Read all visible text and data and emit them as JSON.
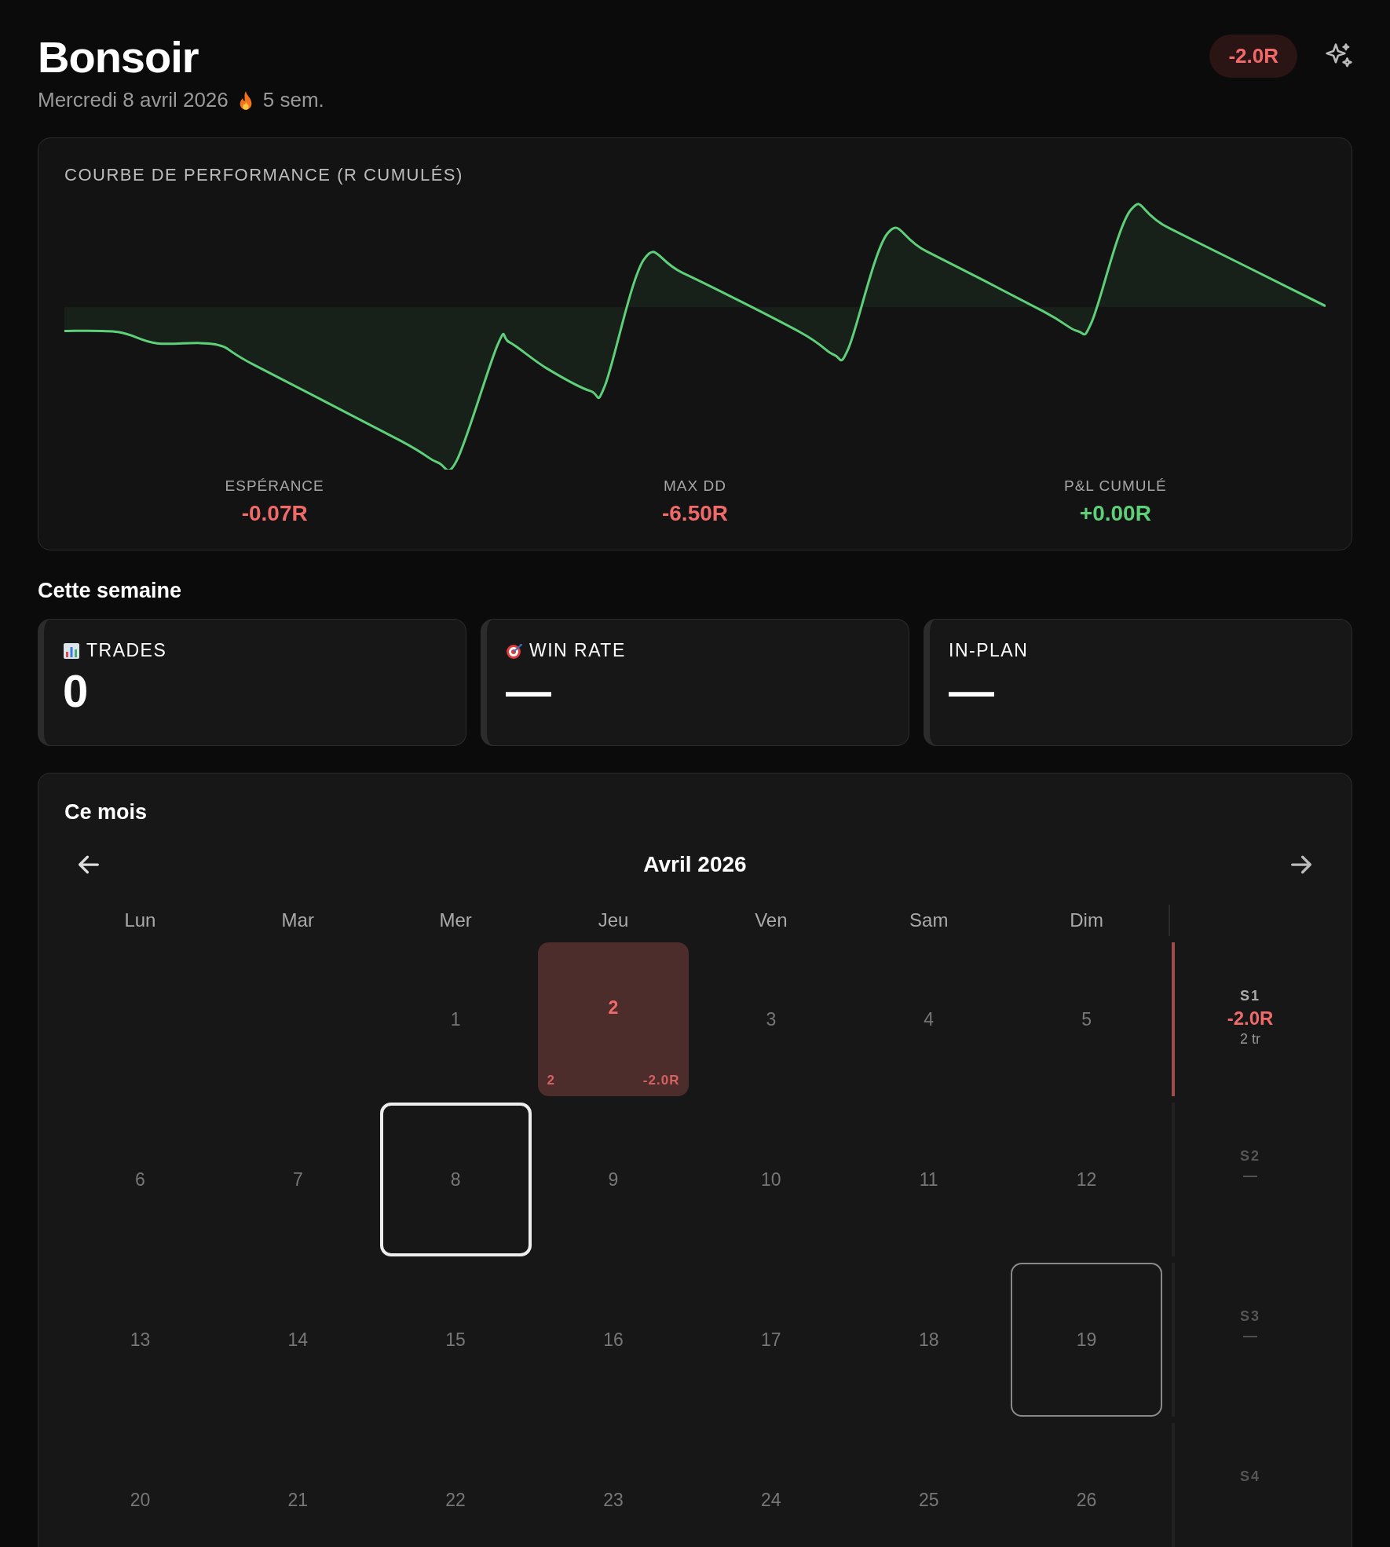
{
  "header": {
    "greeting": "Bonsoir",
    "date": "Mercredi 8 avril 2026",
    "streak": "5 sem.",
    "badge": {
      "text": "-2.0R"
    }
  },
  "performance": {
    "title": "COURBE DE PERFORMANCE (R CUMULÉS)",
    "stats": [
      {
        "label": "ESPÉRANCE",
        "value": "-0.07R",
        "color": "#f06a6a"
      },
      {
        "label": "MAX DD",
        "value": "-6.50R",
        "color": "#f06a6a"
      },
      {
        "label": "P&L CUMULÉ",
        "value": "+0.00R",
        "color": "#5fd07a"
      }
    ]
  },
  "week": {
    "title": "Cette semaine",
    "cards": [
      {
        "kind": "chart",
        "label": "TRADES",
        "value": "0"
      },
      {
        "kind": "target",
        "label": "WIN RATE",
        "value": "—"
      },
      {
        "kind": "plain",
        "label": "IN-PLAN",
        "value": "—"
      }
    ]
  },
  "month": {
    "title": "Ce mois",
    "period": "Avril 2026",
    "weekdays": [
      "Lun",
      "Mar",
      "Mer",
      "Jeu",
      "Ven",
      "Sam",
      "Dim"
    ],
    "weeks": [
      {
        "label": "S1",
        "pnl": "-2.0R",
        "trades": "2 tr",
        "color": "#f06a6a",
        "days": [
          {
            "day": "1",
            "color": "#777777",
            "today": false,
            "selected": false
          },
          {
            "day": "2",
            "trades": "2",
            "pnl": "-2.0R",
            "color": "#f06a6a",
            "today": false,
            "selected": false
          },
          {
            "day": "3",
            "color": "#777777",
            "today": false,
            "selected": false
          },
          {
            "day": "4",
            "color": "#777777",
            "today": false,
            "selected": false
          },
          {
            "day": "5",
            "color": "#777777",
            "today": false,
            "selected": false
          }
        ]
      },
      {
        "label": "S2",
        "pnl": "—",
        "color": "#555555",
        "days": [
          {
            "day": "6",
            "color": "#777777",
            "today": false,
            "selected": false
          },
          {
            "day": "7",
            "color": "#777777",
            "today": false,
            "selected": false
          },
          {
            "day": "8",
            "color": "#777777",
            "today": true,
            "selected": false
          },
          {
            "day": "9",
            "color": "#777777",
            "today": false,
            "selected": false
          },
          {
            "day": "10",
            "color": "#777777",
            "today": false,
            "selected": false
          },
          {
            "day": "11",
            "color": "#777777",
            "today": false,
            "selected": false
          },
          {
            "day": "12",
            "color": "#777777",
            "today": false,
            "selected": false
          }
        ]
      },
      {
        "label": "S3",
        "pnl": "—",
        "color": "#555555",
        "days": [
          {
            "day": "13",
            "color": "#777777",
            "today": false,
            "selected": false
          },
          {
            "day": "14",
            "color": "#777777",
            "today": false,
            "selected": false
          },
          {
            "day": "15",
            "color": "#777777",
            "today": false,
            "selected": false
          },
          {
            "day": "16",
            "color": "#777777",
            "today": false,
            "selected": false
          },
          {
            "day": "17",
            "color": "#777777",
            "today": false,
            "selected": false
          },
          {
            "day": "18",
            "color": "#777777",
            "today": false,
            "selected": false
          },
          {
            "day": "19",
            "color": "#777777",
            "today": false,
            "selected": true
          }
        ]
      },
      {
        "label": "S4",
        "color": "#555555",
        "days": [
          {
            "day": "20",
            "color": "#777777",
            "today": false,
            "selected": false
          },
          {
            "day": "21",
            "color": "#777777",
            "today": false,
            "selected": false
          },
          {
            "day": "22",
            "color": "#777777",
            "today": false,
            "selected": false
          },
          {
            "day": "23",
            "color": "#777777",
            "today": false,
            "selected": false
          },
          {
            "day": "24",
            "color": "#777777",
            "today": false,
            "selected": false
          },
          {
            "day": "25",
            "color": "#777777",
            "today": false,
            "selected": false
          },
          {
            "day": "26",
            "color": "#777777",
            "today": false,
            "selected": false
          }
        ]
      }
    ]
  }
}
